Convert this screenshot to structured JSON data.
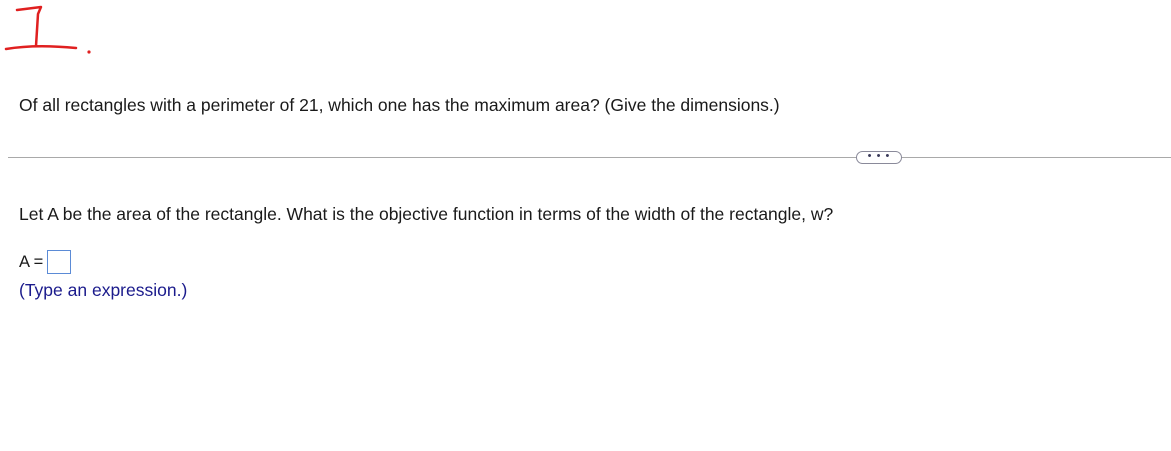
{
  "annotation": {
    "mark": "1.",
    "ink_color": "#e02020"
  },
  "question": {
    "text": "Of all rectangles with a perimeter of 21, which one has the maximum area? (Give the dimensions.)"
  },
  "more_button": {
    "label": "• • •",
    "icon": "ellipsis-icon"
  },
  "step": {
    "prompt": "Let A be the area of the rectangle. What is the objective function in terms of the width of the rectangle, w?",
    "answer_label": "A =",
    "answer_value": "",
    "hint": "(Type an expression.)"
  },
  "colors": {
    "text": "#1a1a1a",
    "hint": "#1b1b8c",
    "input_border": "#5b8bd6",
    "divider": "#a9a9a9"
  }
}
